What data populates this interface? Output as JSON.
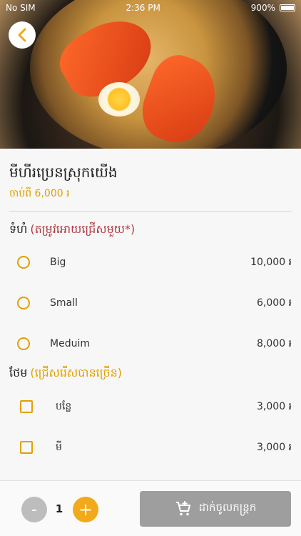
{
  "status_bar": {
    "carrier": "No SIM",
    "time": "2:36 PM",
    "battery": "900%"
  },
  "icons": {
    "back": "chevron-left-icon",
    "cart": "add-to-cart-icon",
    "wifi": "wifi-icon",
    "battery": "battery-icon"
  },
  "product": {
    "name": "មីហីរប្រេនស្រុកយើង",
    "price_from": "ចាប់ពី 6,000 ៛"
  },
  "size_section": {
    "title": "ទំហំ",
    "hint": "(តម្រូវអោយជ្រើសមួយ*)",
    "options": [
      {
        "name": "Big",
        "price": "10,000 ៛"
      },
      {
        "name": "Small",
        "price": "6,000 ៛"
      },
      {
        "name": "Meduim",
        "price": "8,000 ៛"
      }
    ]
  },
  "addon_section": {
    "title": "ថែម",
    "hint": "(ជ្រើសរើសបានច្រើន)",
    "options": [
      {
        "name": "បន្លែ",
        "price": "3,000 ៛"
      },
      {
        "name": "មី",
        "price": "3,000 ៛"
      }
    ]
  },
  "footer": {
    "minus": "-",
    "quantity": "1",
    "plus": "+",
    "add_to_cart": "ដាក់ចូលកន្ត្រក"
  },
  "colors": {
    "accent": "#e0a100",
    "required_hint": "#b23b45",
    "disabled_button": "#9e9e9e"
  }
}
